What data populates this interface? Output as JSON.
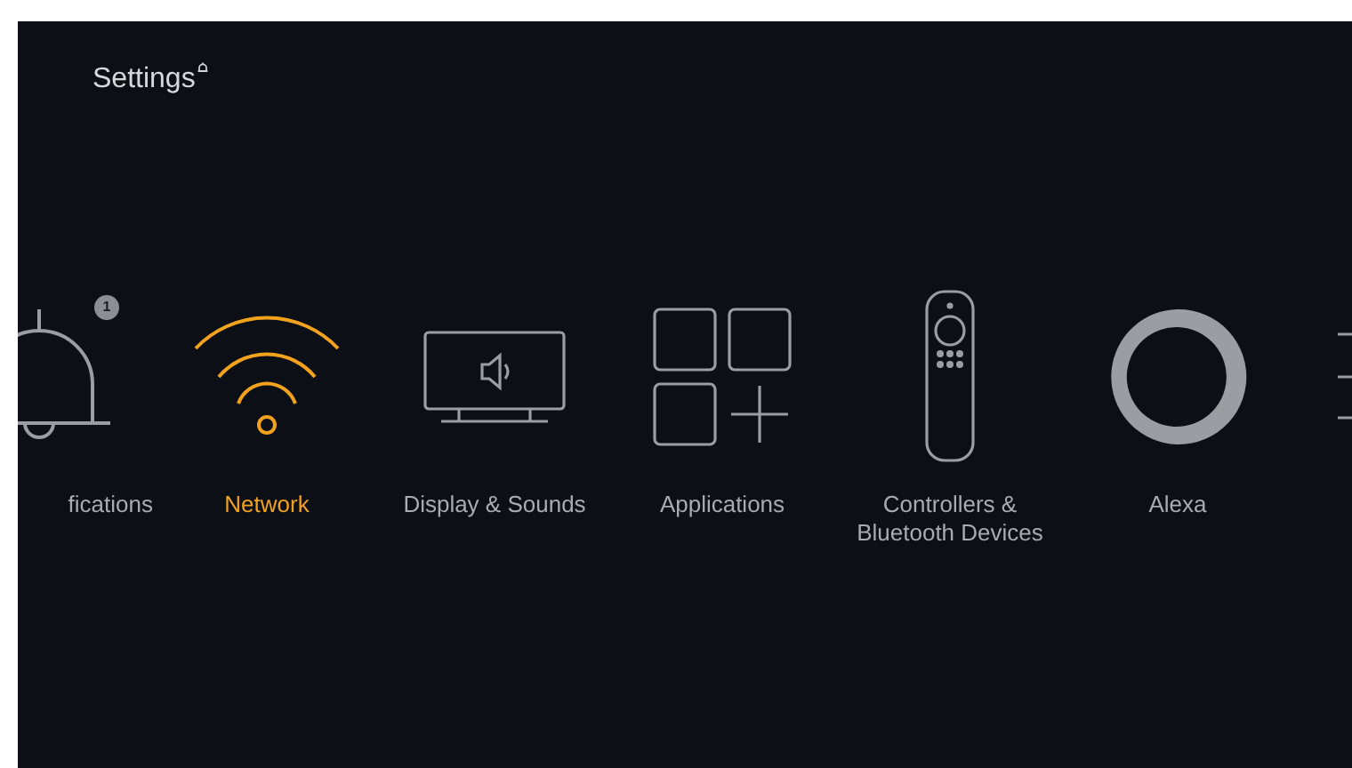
{
  "header": {
    "title": "Settings"
  },
  "items": [
    {
      "kind": "bell",
      "label": "fications",
      "cut": true,
      "badge": "1",
      "selected": false
    },
    {
      "kind": "wifi",
      "label": "Network",
      "cut": false,
      "selected": true
    },
    {
      "kind": "tv",
      "label": "Display & Sounds",
      "cut": false,
      "selected": false
    },
    {
      "kind": "apps",
      "label": "Applications",
      "cut": false,
      "selected": false
    },
    {
      "kind": "remote",
      "label": "Controllers & Bluetooth Devices",
      "cut": false,
      "selected": false
    },
    {
      "kind": "alexa",
      "label": "Alexa",
      "cut": false,
      "selected": false
    },
    {
      "kind": "lines",
      "selected": false
    }
  ]
}
